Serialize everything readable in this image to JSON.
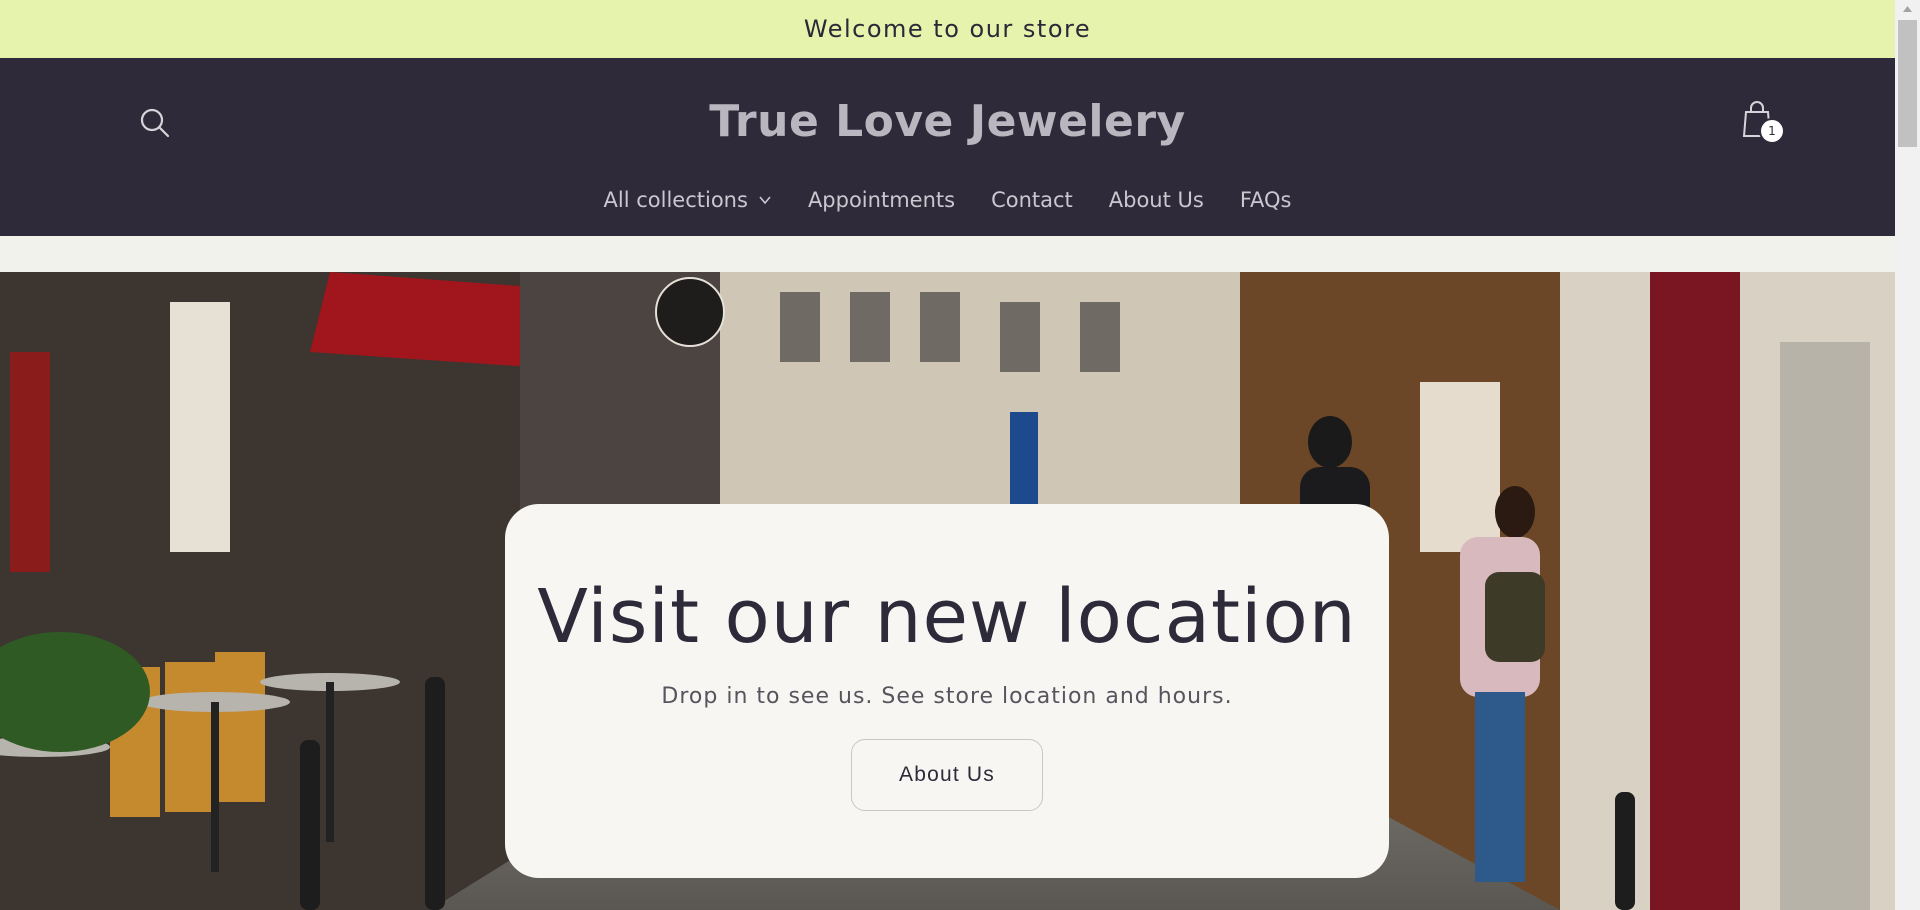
{
  "announcement": {
    "text": "Welcome to our store"
  },
  "header": {
    "title": "True Love Jewelery",
    "cart_count": "1",
    "nav": [
      {
        "label": "All collections",
        "has_dropdown": true
      },
      {
        "label": "Appointments"
      },
      {
        "label": "Contact"
      },
      {
        "label": "About Us"
      },
      {
        "label": "FAQs"
      }
    ]
  },
  "hero": {
    "heading": "Visit our new location",
    "subtext": "Drop in to see us. See store location and hours.",
    "button_label": "About Us"
  },
  "colors": {
    "announcement_bg": "#e5f3ad",
    "header_bg": "#2e2a39",
    "card_bg": "#f8f6f2",
    "text_dark": "#2d2a3a"
  },
  "icons": {
    "search": "search-icon",
    "cart": "cart-icon",
    "dropdown": "chevron-down-icon"
  }
}
